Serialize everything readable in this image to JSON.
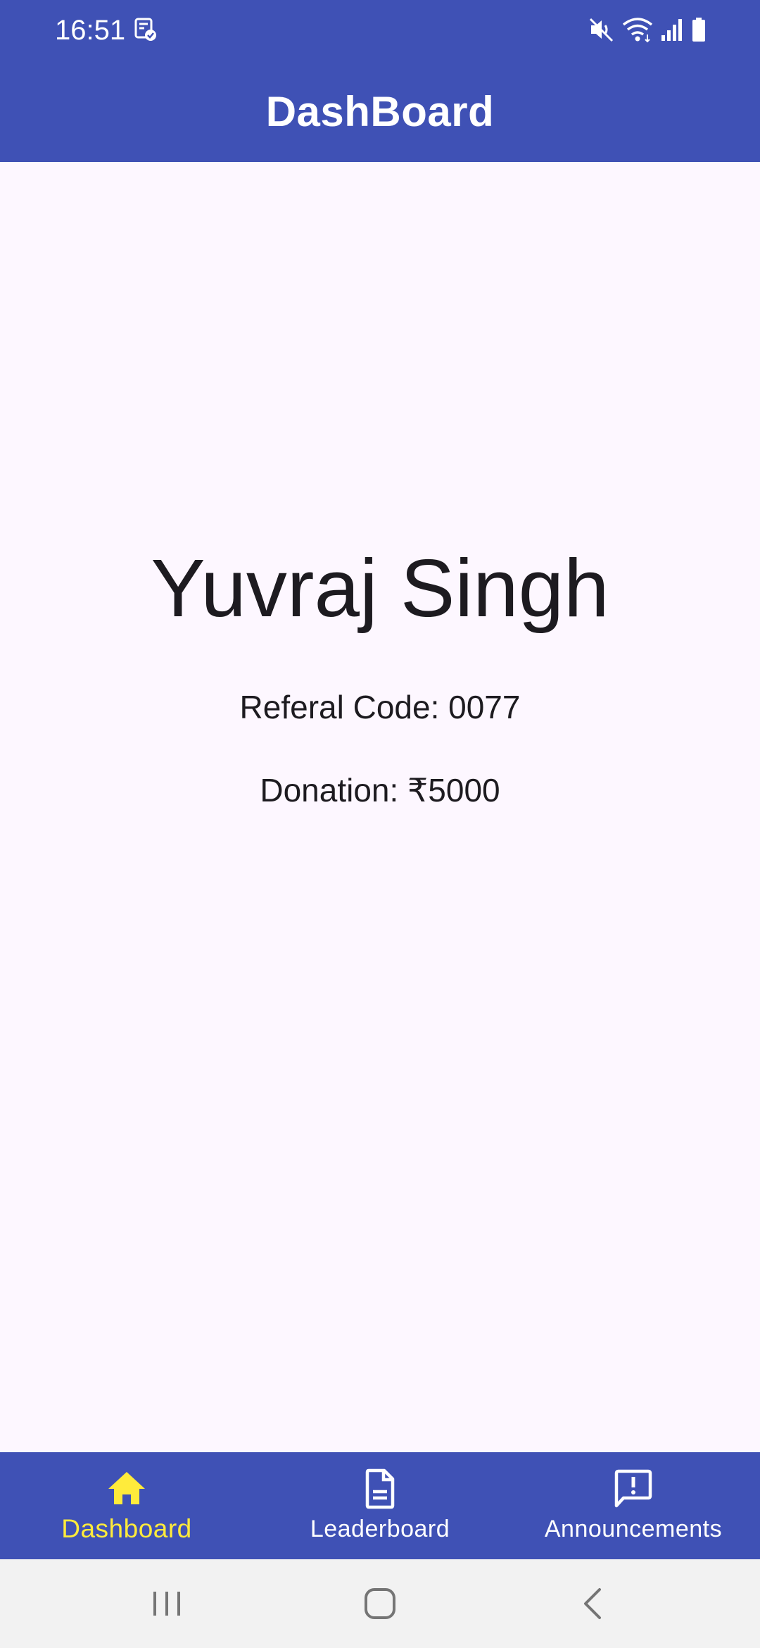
{
  "status_bar": {
    "time": "16:51",
    "icons": [
      "screenshot-notification-icon",
      "mute-icon",
      "wifi-icon",
      "signal-icon",
      "battery-icon"
    ]
  },
  "app_bar": {
    "title": "DashBoard"
  },
  "profile": {
    "name": "Yuvraj Singh",
    "referral": "Referal Code: 0077",
    "donation": "Donation: ₹5000"
  },
  "bottom_nav": {
    "items": [
      {
        "label": "Dashboard",
        "icon": "home-icon",
        "active": true
      },
      {
        "label": "Leaderboard",
        "icon": "document-icon",
        "active": false
      },
      {
        "label": "Announcements",
        "icon": "announcement-icon",
        "active": false
      }
    ]
  },
  "system_nav": {
    "buttons": [
      "recents-button",
      "home-button",
      "back-button"
    ]
  },
  "colors": {
    "primary": "#3f51b5",
    "active_nav": "#ffeb3b",
    "background": "#fdf7ff",
    "text": "#1d1b20"
  }
}
